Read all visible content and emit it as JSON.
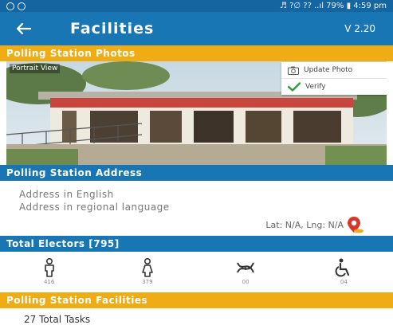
{
  "status_bar": {
    "right_text": "♬ ?∅ ?? ..ıl 79% ▮ 4:59 pm"
  },
  "app_bar": {
    "title": "Facilities",
    "version": "V 2.20"
  },
  "photos_section": {
    "header": "Polling Station Photos",
    "photo_label": "Portrait View",
    "update_photo_label": "Update Photo",
    "verify_label": "Verify"
  },
  "address_section": {
    "header": "Polling Station Address",
    "address_english": "Address in English",
    "address_regional": "Address in regional language",
    "lat_lng": "Lat: N/A, Lng: N/A"
  },
  "electors_section": {
    "header": "Total Electors [795]",
    "items": [
      {
        "icon": "male-icon",
        "count": "416"
      },
      {
        "icon": "female-icon",
        "count": "379"
      },
      {
        "icon": "third-gender-icon",
        "count": "00"
      },
      {
        "icon": "wheelchair-icon",
        "count": "04"
      }
    ]
  },
  "facilities_section": {
    "header": "Polling Station Facilities",
    "tasks_text": "27 Total Tasks"
  },
  "colors": {
    "primary": "#1976b5",
    "accent": "#f0ac14",
    "verify_check": "#2e9b3e"
  }
}
